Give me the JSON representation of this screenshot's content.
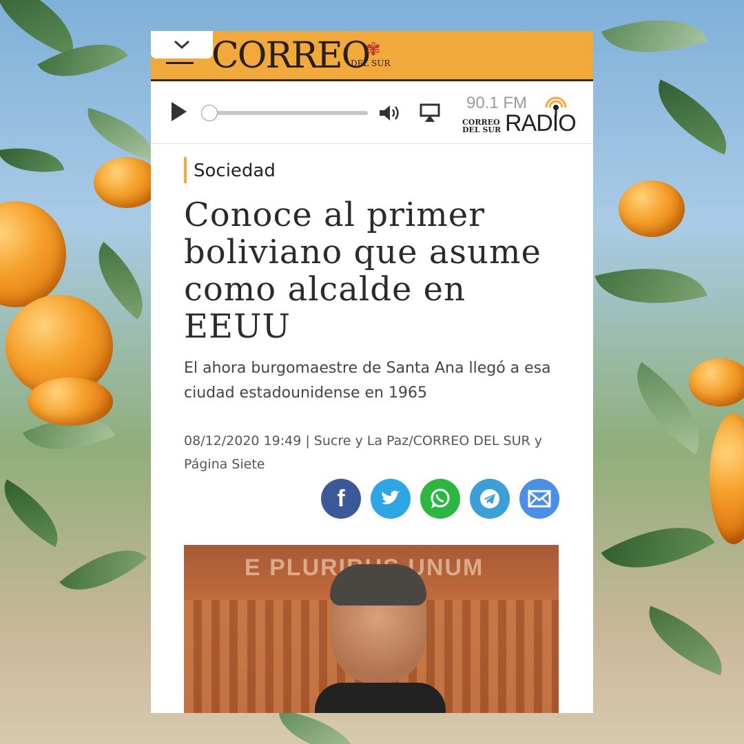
{
  "header": {
    "collapse_icon": "chevron-down-icon",
    "menu_icon": "hamburger-icon",
    "logo_main": "CORREO",
    "logo_sub": "DEL SUR"
  },
  "player": {
    "play_icon": "play-icon",
    "progress": 0,
    "volume_icon": "volume-icon",
    "airplay_icon": "airplay-icon",
    "frequency": "90.1 FM",
    "station_brand_line1": "CORREO",
    "station_brand_line2": "DEL SUR",
    "station_word": "RADIO"
  },
  "article": {
    "section": "Sociedad",
    "headline": "Conoce al primer boliviano que asume como alcalde en EEUU",
    "lede": "El ahora burgomaestre de Santa Ana llegó a esa ciudad estadounidense en 1965",
    "meta": "08/12/2020 19:49 | Sucre y La Paz/CORREO DEL SUR y Página Siete",
    "photo_text": "E PLURIBUS UNUM"
  },
  "share": [
    {
      "name": "facebook",
      "icon": "facebook-icon",
      "color": "#3b5998"
    },
    {
      "name": "twitter",
      "icon": "twitter-icon",
      "color": "#2ea6e6"
    },
    {
      "name": "whatsapp",
      "icon": "whatsapp-icon",
      "color": "#2cb742"
    },
    {
      "name": "telegram",
      "icon": "telegram-icon",
      "color": "#3c9fd8"
    },
    {
      "name": "email",
      "icon": "email-icon",
      "color": "#4c8fe6"
    }
  ],
  "colors": {
    "accent": "#f2a93b",
    "text": "#2b2b2b"
  }
}
